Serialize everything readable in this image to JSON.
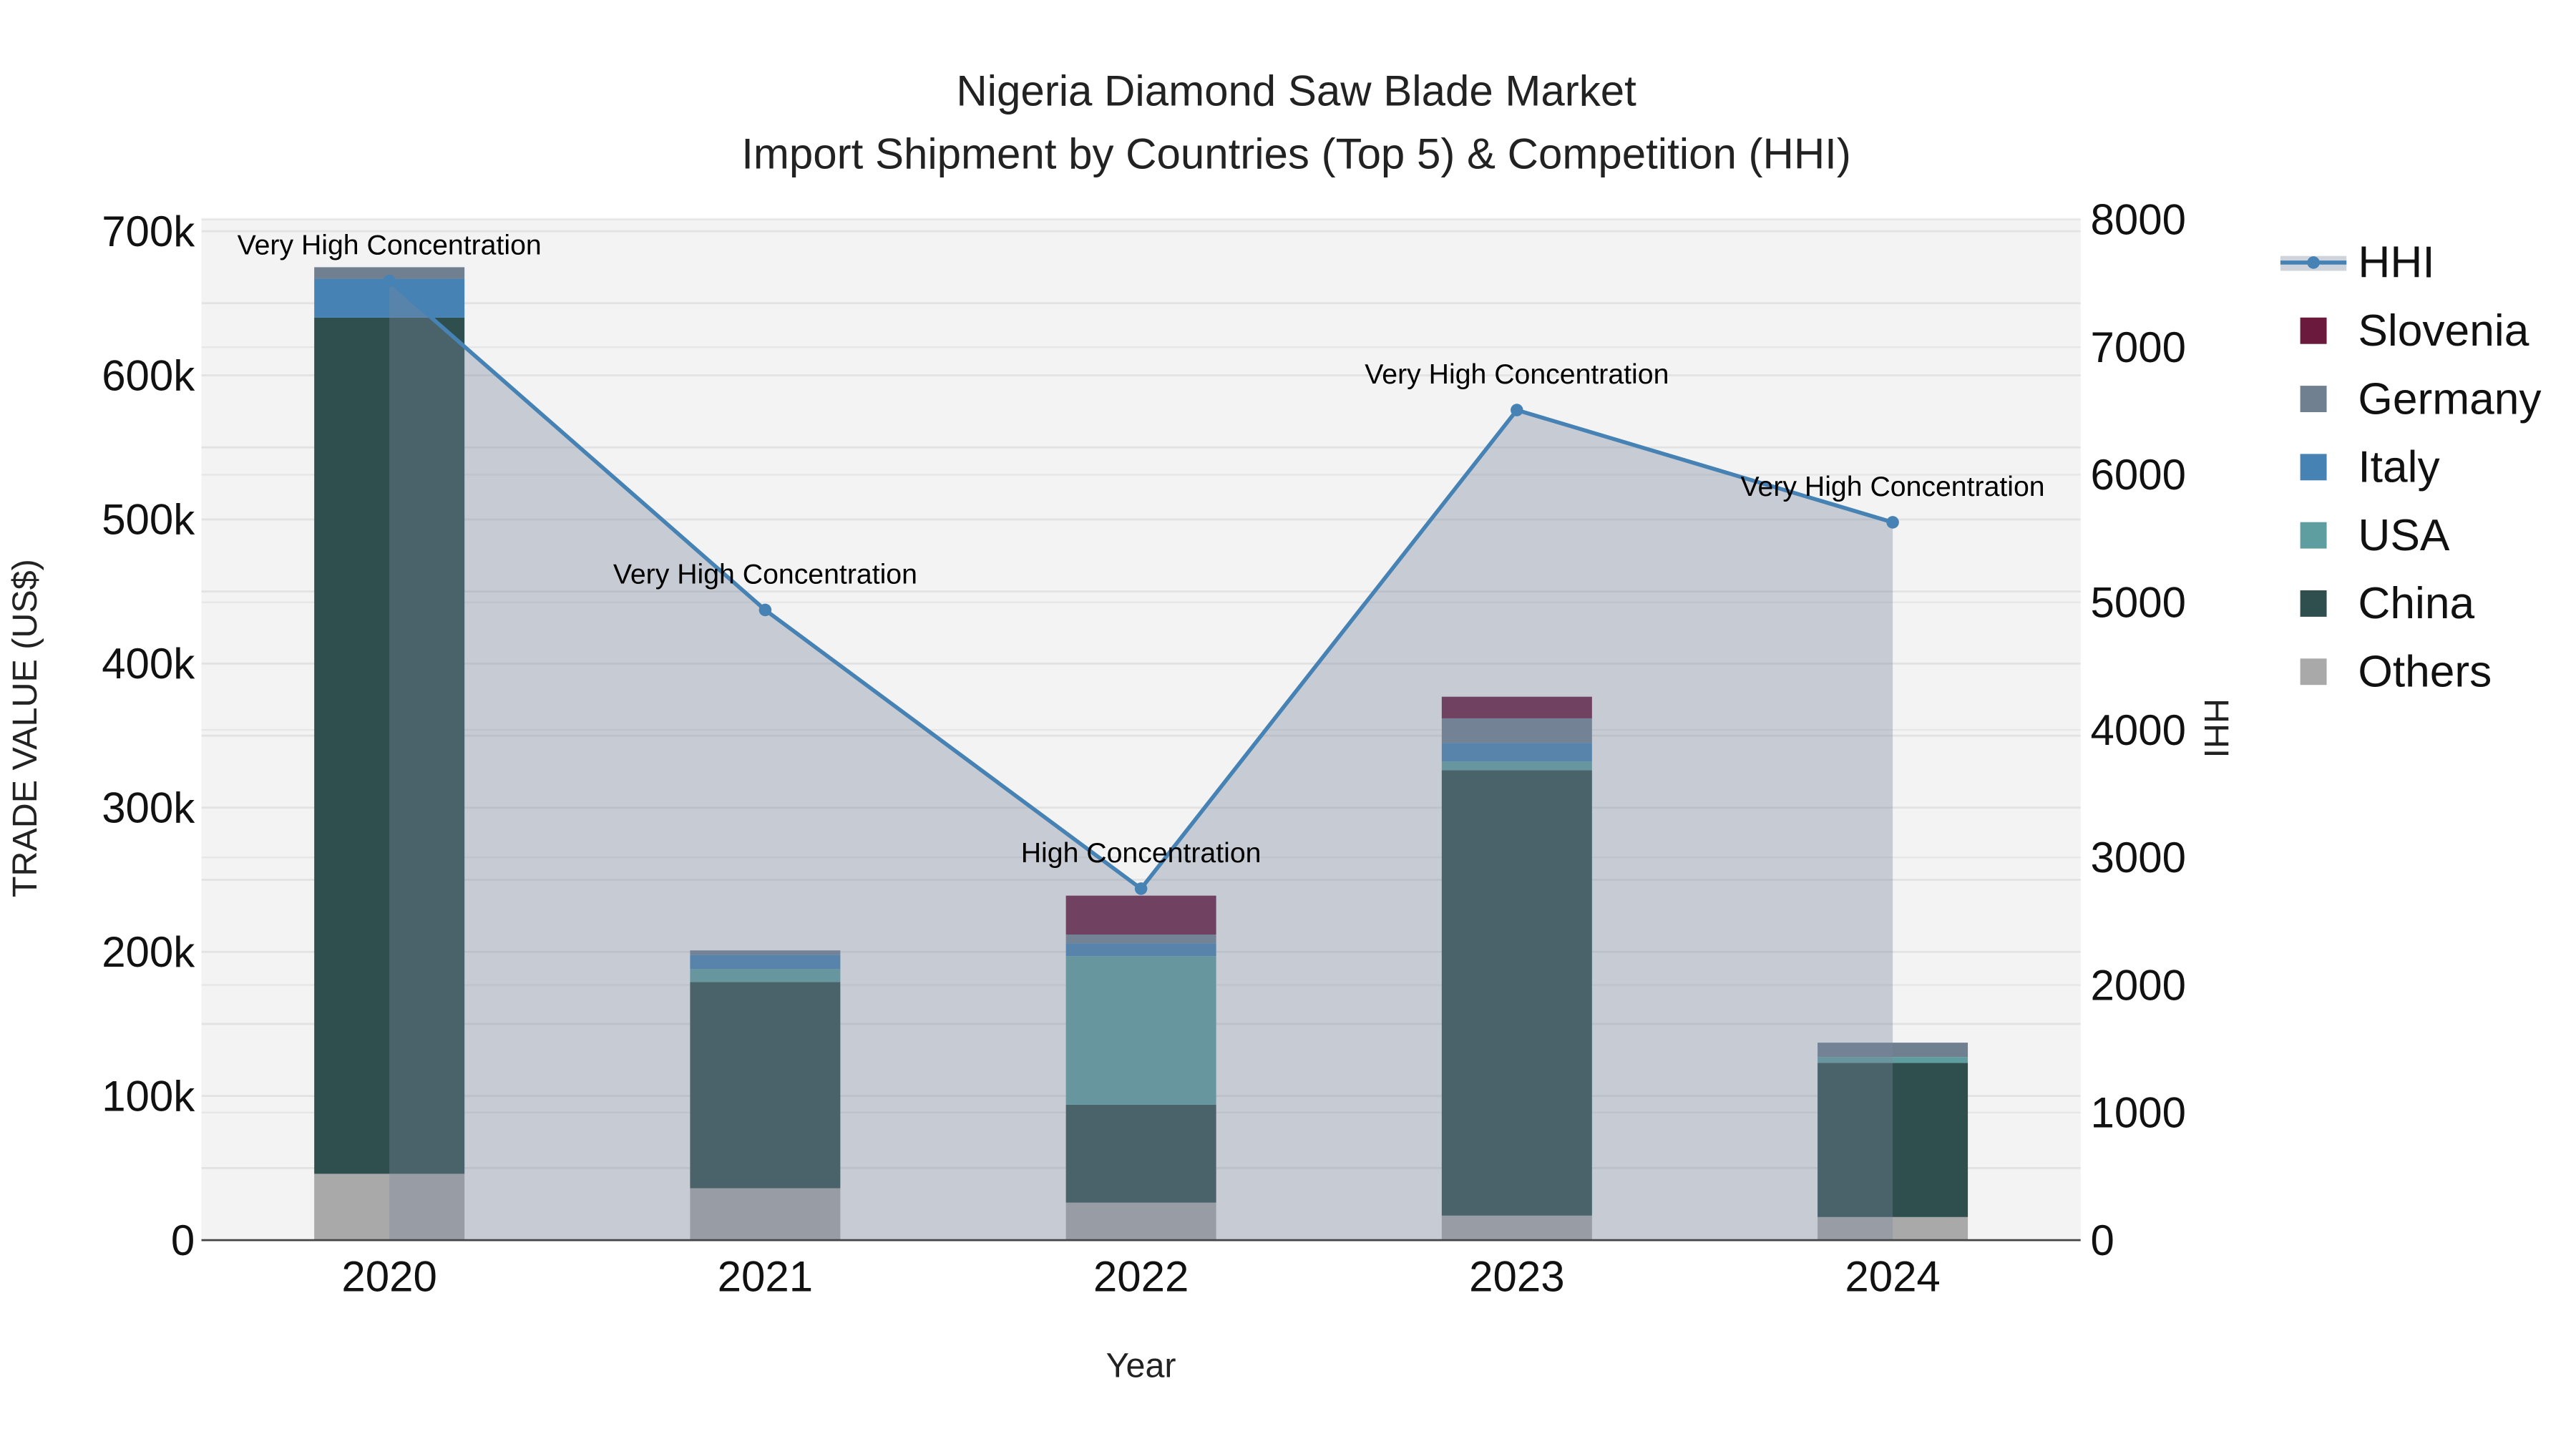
{
  "chart_data": {
    "type": "bar",
    "title": "Nigeria Diamond Saw Blade Market",
    "subtitle": "Import Shipment by Countries (Top 5) & Competition (HHI)",
    "xlabel": "Year",
    "ylabel": "TRADE VALUE (US$)",
    "y2label": "HHI",
    "categories": [
      "2020",
      "2021",
      "2022",
      "2023",
      "2024"
    ],
    "ylim": [
      0,
      700000
    ],
    "y2lim": [
      0,
      8000
    ],
    "yticks": [
      "0",
      "100k",
      "200k",
      "300k",
      "400k",
      "500k",
      "600k",
      "700k"
    ],
    "y2ticks": [
      "0",
      "1000",
      "2000",
      "3000",
      "4000",
      "5000",
      "6000",
      "7000",
      "8000"
    ],
    "stacked": true,
    "series": [
      {
        "name": "Others",
        "color": "#a9a9a9",
        "values": [
          46000,
          36000,
          26000,
          17000,
          16000
        ]
      },
      {
        "name": "China",
        "color": "#2f4f4f",
        "values": [
          594000,
          143000,
          68000,
          309000,
          107000
        ]
      },
      {
        "name": "USA",
        "color": "#5f9ea0",
        "values": [
          0,
          9000,
          103000,
          6000,
          4000
        ]
      },
      {
        "name": "Italy",
        "color": "#4682b4",
        "values": [
          27000,
          10000,
          9000,
          13000,
          0
        ]
      },
      {
        "name": "Germany",
        "color": "#708090",
        "values": [
          8000,
          3000,
          6000,
          17000,
          10000
        ]
      },
      {
        "name": "Slovenia",
        "color": "#6b1a3d",
        "values": [
          0,
          0,
          27000,
          15000,
          0
        ]
      }
    ],
    "hhi": {
      "name": "HHI",
      "color": "#4682b4",
      "values": [
        7520,
        4940,
        2755,
        6507,
        5627
      ],
      "labels": [
        "Very High Concentration",
        "Very High Concentration",
        "High Concentration",
        "Very High Concentration",
        "Very High Concentration"
      ]
    },
    "legend": {
      "placement": "right",
      "order": [
        "HHI",
        "Slovenia",
        "Germany",
        "Italy",
        "USA",
        "China",
        "Others"
      ]
    },
    "grid": true
  }
}
